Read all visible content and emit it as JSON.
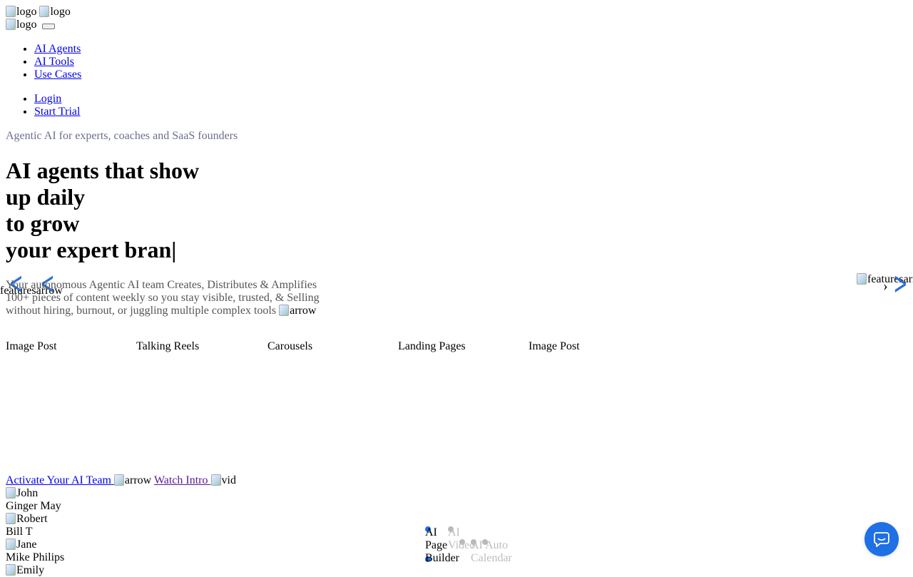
{
  "header": {
    "logos": [
      "logo",
      "logo"
    ],
    "home_logo": "logo",
    "nav_items": [
      "AI Agents",
      "AI Tools",
      "Use Cases"
    ],
    "auth_items": [
      "Login",
      "Start Trial"
    ]
  },
  "hero": {
    "eyebrow": "Agentic AI for experts, coaches and SaaS founders",
    "headline_lines": [
      "AI agents that show",
      "up daily",
      "to grow",
      "your expert bran|"
    ],
    "subtext": "Your autonomous Agentic AI team Creates, Distributes & Amplifies 100+ pieces of content weekly so you stay visible, trusted, & Selling without hiring, burnout, or juggling multiple complex tools",
    "subtext_img_alt": "arrow",
    "left_img_alt": "featuresarrow",
    "right_img_alt": "featuresarrow"
  },
  "tabs": [
    "Image Post",
    "Talking Reels",
    "Carousels",
    "Landing Pages",
    "Image Post"
  ],
  "cta": {
    "primary_label": "Activate Your AI Team",
    "primary_img_alt": "arrow",
    "secondary_label": "Watch Intro",
    "secondary_img_alt": "vid"
  },
  "testimonials": [
    {
      "img_alt": "John",
      "name": "Ginger May"
    },
    {
      "img_alt": "Robert",
      "name": "Bill T"
    },
    {
      "img_alt": "Jane",
      "name": "Mike Philips"
    },
    {
      "img_alt": "Emily",
      "name": ""
    }
  ],
  "feature_slider": {
    "active_label_lines": [
      "AI",
      "Page",
      "Builder"
    ],
    "ghost_labels": [
      "AI",
      "Video",
      "AI Auto",
      "Calendar"
    ]
  },
  "colors": {
    "link": "#0000ee",
    "visited": "#551a8b",
    "accent": "#1f6fe5",
    "eyebrow": "#6b6e8e"
  },
  "icons": {
    "chat_launcher": "chat-bubble-icon",
    "prev": "chevron-left-icon",
    "next": "chevron-right-icon"
  }
}
